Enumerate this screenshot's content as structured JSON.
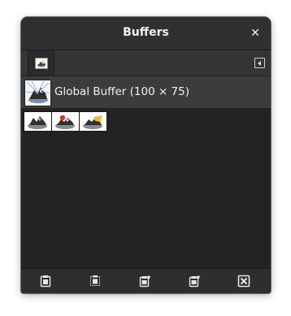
{
  "window": {
    "title": "Buffers",
    "close_label": "✕"
  },
  "tabs": [
    {
      "icon": "buffers-tab-icon"
    }
  ],
  "global_buffer": {
    "label": "Global Buffer (100 × 75)"
  },
  "buffers": [
    {
      "icon": "wilber-thumbnail"
    },
    {
      "icon": "wilber-red-thumbnail"
    },
    {
      "icon": "wilber-yellow-thumbnail"
    }
  ],
  "toolbar": [
    {
      "name": "paste-buffer-button",
      "icon": "paste-icon"
    },
    {
      "name": "paste-into-selection-button",
      "icon": "paste-into-icon"
    },
    {
      "name": "paste-as-new-layer-button",
      "icon": "paste-new-layer-icon"
    },
    {
      "name": "paste-as-new-image-button",
      "icon": "paste-new-image-icon"
    },
    {
      "name": "delete-buffer-button",
      "icon": "delete-icon"
    }
  ]
}
